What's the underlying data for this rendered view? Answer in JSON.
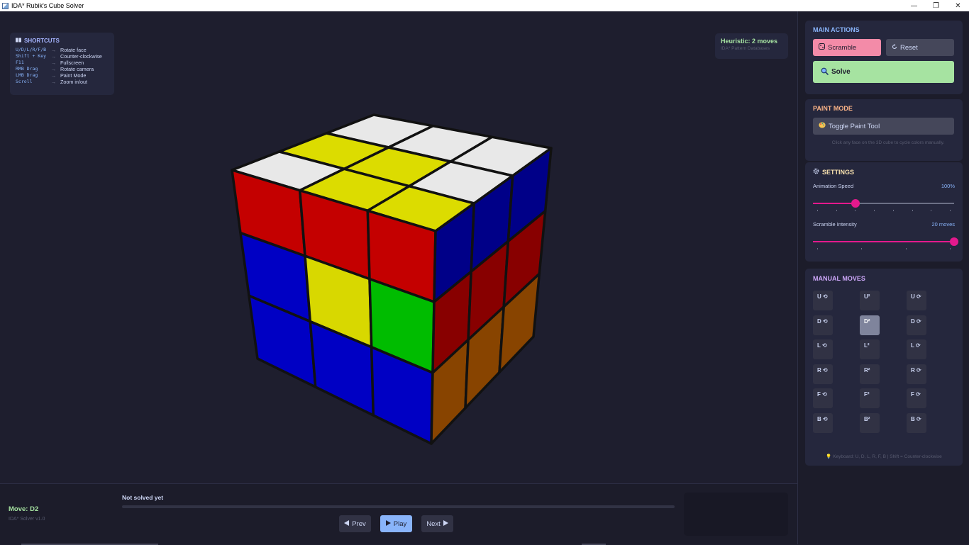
{
  "window": {
    "title": "IDA* Rubik's Cube Solver",
    "controls": [
      "—",
      "❐",
      "✕"
    ]
  },
  "shortcuts": {
    "title": "SHORTCUTS",
    "arrow": "→",
    "rows": [
      {
        "key": "U/D/L/R/F/B",
        "action": "Rotate face"
      },
      {
        "key": "Shift + Key",
        "action": "Counter-clockwise"
      },
      {
        "key": "F11",
        "action": "Fullscreen"
      },
      {
        "key": "RMB Drag",
        "action": "Rotate camera"
      },
      {
        "key": "LMB Drag",
        "action": "Paint Mode"
      },
      {
        "key": "Scroll",
        "action": "Zoom in/out"
      }
    ]
  },
  "heuristic": {
    "label": "Heuristic: 2 moves",
    "sub": "IDA* Pattern Databases"
  },
  "cube": {
    "colors": {
      "white": "#e8e8e8",
      "yellow": "#dcdc00",
      "red": "#c80000",
      "blue": "#0000c8",
      "green": "#00c000",
      "orange": "#c86400"
    },
    "top": [
      "white",
      "white",
      "white",
      "yellow",
      "yellow",
      "white",
      "white",
      "yellow",
      "yellow"
    ],
    "front": [
      "red",
      "red",
      "red",
      "blue",
      "yellow",
      "green",
      "blue",
      "blue",
      "blue"
    ],
    "right": [
      "blue",
      "blue",
      "blue",
      "red",
      "red",
      "red",
      "orange",
      "orange",
      "orange"
    ]
  },
  "bottom": {
    "move": "Move: D2",
    "version": "IDA* Solver v1.0",
    "status": "Not solved yet",
    "progress": 0,
    "prev": "Prev",
    "play": "Play",
    "next": "Next"
  },
  "sidebar": {
    "main_actions": {
      "title": "MAIN ACTIONS",
      "scramble": "Scramble",
      "reset": "Reset",
      "solve": "Solve"
    },
    "paint_mode": {
      "title": "PAINT MODE",
      "toggle": "Toggle Paint Tool",
      "hint": "Click any face on the 3D cube to cycle colors manually."
    },
    "settings": {
      "title": "SETTINGS",
      "animation_label": "Animation Speed",
      "animation_value": "100%",
      "animation_fraction": 0.3,
      "scramble_label": "Scramble Intensity",
      "scramble_value": "20 moves",
      "scramble_fraction": 1.0
    },
    "manual_moves": {
      "title": "MANUAL MOVES",
      "rows": [
        [
          "U ⟲",
          "U²",
          "U ⟳"
        ],
        [
          "D ⟲",
          "D²",
          "D ⟳"
        ],
        [
          "L ⟲",
          "L²",
          "L ⟳"
        ],
        [
          "R ⟲",
          "R²",
          "R ⟳"
        ],
        [
          "F ⟲",
          "F²",
          "F ⟳"
        ],
        [
          "B ⟲",
          "B²",
          "B ⟳"
        ]
      ],
      "active": "D²",
      "hint": "💡 Keyboard: U, D, L, R, F, B | Shift = Counter-clockwise"
    }
  }
}
